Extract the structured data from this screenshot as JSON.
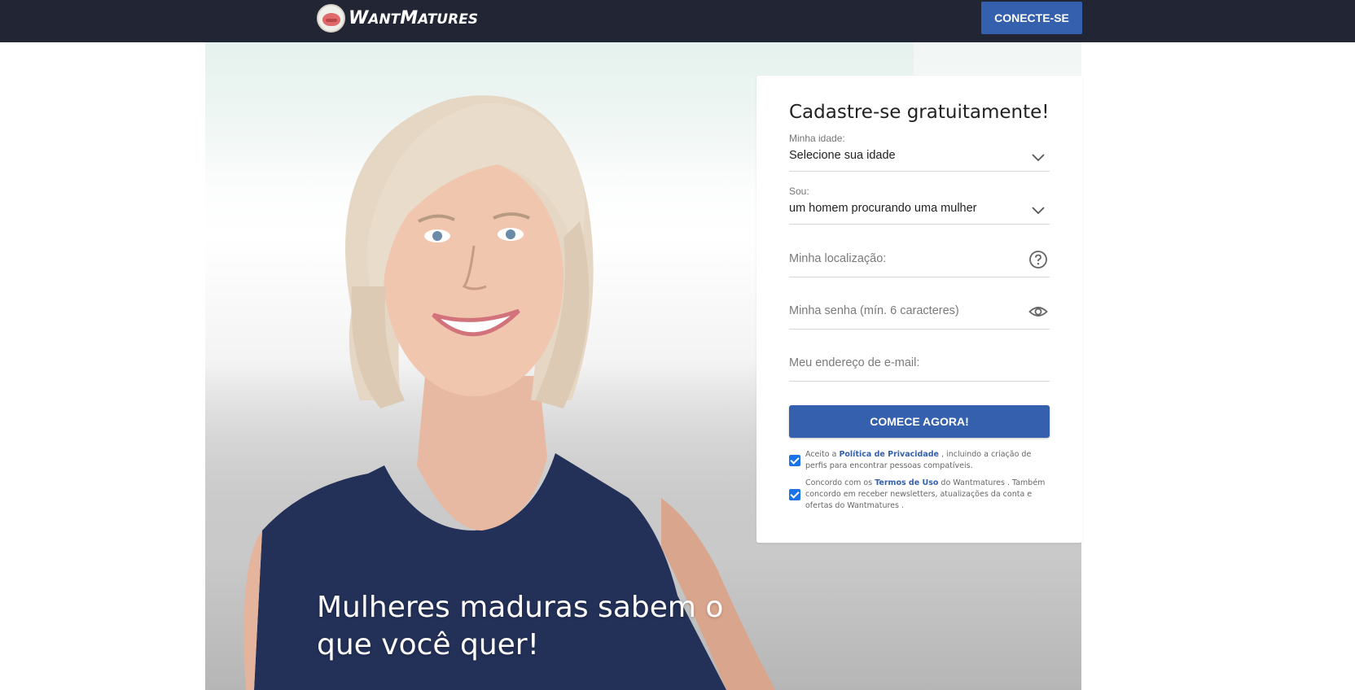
{
  "header": {
    "logo_text_first": "W",
    "logo_text_rest": "ANT",
    "logo_text_second_first": "M",
    "logo_text_second_rest": "ATURES",
    "login_button": "CONECTE-SE"
  },
  "hero": {
    "headline": "Mulheres maduras sabem o que você quer!"
  },
  "signup": {
    "title": "Cadastre-se gratuitamente!",
    "age": {
      "label": "Minha idade:",
      "value": "Selecione sua idade"
    },
    "seeking": {
      "label": "Sou:",
      "value": "um homem procurando uma mulher"
    },
    "location": {
      "placeholder": "Minha localização:"
    },
    "password": {
      "placeholder": "Minha senha (mín. 6 caracteres)"
    },
    "email": {
      "placeholder": "Meu endereço de e-mail:"
    },
    "submit": "COMECE AGORA!",
    "consent_privacy": {
      "checked": true,
      "prefix": "Aceito a ",
      "link": "Política de Privacidade",
      "suffix": " , incluindo a criação de perfis para encontrar pessoas compatíveis."
    },
    "consent_terms": {
      "checked": true,
      "prefix": "Concordo com os ",
      "link": "Termos de Uso",
      "suffix": " do Wantmatures . Também concordo em receber newsletters, atualizações da conta e ofertas do Wantmatures ."
    }
  },
  "colors": {
    "header_bg": "#222634",
    "accent": "#3560ad",
    "checkbox": "#1a73e8"
  }
}
